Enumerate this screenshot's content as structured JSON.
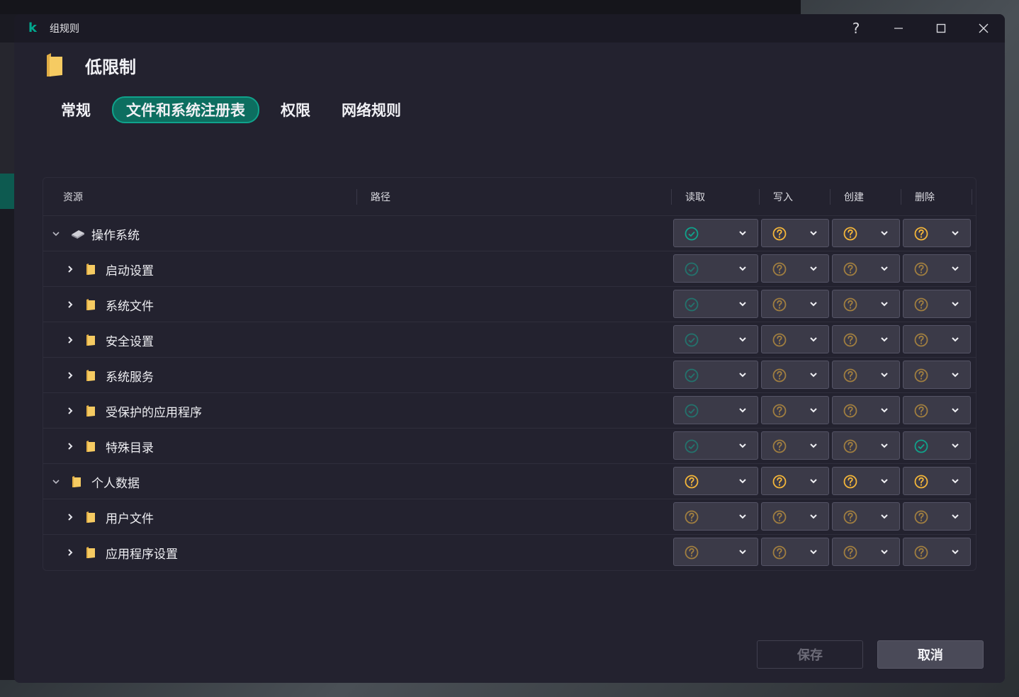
{
  "window": {
    "title": "组规则",
    "help_glyph": "?",
    "colors": {
      "accent": "#00a88e",
      "folder": "#f4c55a",
      "granted": "#10a38c",
      "ask": "#f4b63a"
    }
  },
  "header": {
    "title": "低限制",
    "icon": "folder-icon"
  },
  "tabs": [
    {
      "label": "常规",
      "active": false
    },
    {
      "label": "文件和系统注册表",
      "active": true
    },
    {
      "label": "权限",
      "active": false
    },
    {
      "label": "网络规则",
      "active": false
    }
  ],
  "table": {
    "columns": {
      "resource": "资源",
      "path": "路径",
      "read": "读取",
      "write": "写入",
      "create": "创建",
      "delete": "删除"
    },
    "rows": [
      {
        "label": "操作系统",
        "level": 0,
        "expanded": true,
        "icon": "chip-icon",
        "perms": [
          "allow",
          "ask",
          "ask",
          "ask"
        ],
        "inherited": false
      },
      {
        "label": "启动设置",
        "level": 1,
        "expanded": false,
        "icon": "folder-icon",
        "perms": [
          "allow",
          "ask",
          "ask",
          "ask"
        ],
        "inherited": true
      },
      {
        "label": "系统文件",
        "level": 1,
        "expanded": false,
        "icon": "folder-icon",
        "perms": [
          "allow",
          "ask",
          "ask",
          "ask"
        ],
        "inherited": true
      },
      {
        "label": "安全设置",
        "level": 1,
        "expanded": false,
        "icon": "folder-icon",
        "perms": [
          "allow",
          "ask",
          "ask",
          "ask"
        ],
        "inherited": true
      },
      {
        "label": "系统服务",
        "level": 1,
        "expanded": false,
        "icon": "folder-icon",
        "perms": [
          "allow",
          "ask",
          "ask",
          "ask"
        ],
        "inherited": true
      },
      {
        "label": "受保护的应用程序",
        "level": 1,
        "expanded": false,
        "icon": "folder-icon",
        "perms": [
          "allow",
          "ask",
          "ask",
          "ask"
        ],
        "inherited": true
      },
      {
        "label": "特殊目录",
        "level": 1,
        "expanded": false,
        "icon": "folder-icon",
        "perms": [
          "allow",
          "ask",
          "ask",
          "allow-explicit"
        ],
        "inherited": true
      },
      {
        "label": "个人数据",
        "level": 0,
        "expanded": true,
        "icon": "folder-icon",
        "perms": [
          "ask",
          "ask",
          "ask",
          "ask"
        ],
        "inherited": false
      },
      {
        "label": "用户文件",
        "level": 1,
        "expanded": false,
        "icon": "folder-icon",
        "perms": [
          "ask",
          "ask",
          "ask",
          "ask"
        ],
        "inherited": true
      },
      {
        "label": "应用程序设置",
        "level": 1,
        "expanded": false,
        "icon": "folder-icon",
        "perms": [
          "ask",
          "ask",
          "ask",
          "ask"
        ],
        "inherited": true
      }
    ]
  },
  "footer": {
    "save_label": "保存",
    "cancel_label": "取消"
  }
}
